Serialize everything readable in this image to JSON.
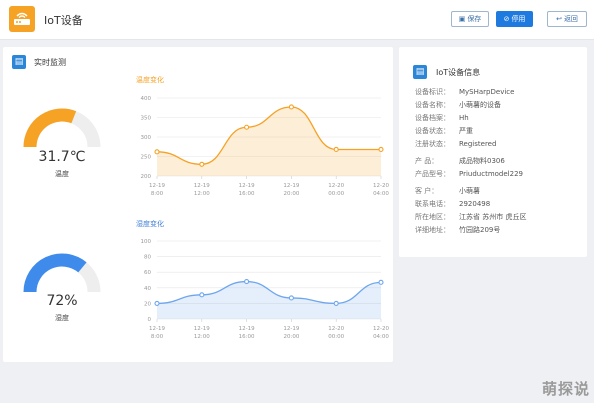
{
  "header": {
    "title": "IoT设备",
    "save_label": "保存",
    "disable_label": "停用",
    "back_label": "返回"
  },
  "monitor": {
    "title": "实时监测",
    "temp_gauge": {
      "value": "31.7℃",
      "label": "温度",
      "level": 0.62,
      "color": "#f5a225"
    },
    "hum_gauge": {
      "value": "72%",
      "label": "湿度",
      "level": 0.72,
      "color": "#3e8bec"
    }
  },
  "info": {
    "title": "IoT设备信息",
    "rows": [
      {
        "key": "设备标识：",
        "value": "MySHarpDevice"
      },
      {
        "key": "设备名称：",
        "value": "小萌薯的设备"
      },
      {
        "key": "设备档案：",
        "value": "Hh"
      },
      {
        "key": "设备状态：",
        "value": "严重"
      },
      {
        "key": "注册状态：",
        "value": "Registered"
      },
      {
        "key": "产    品：",
        "value": "成品物料0306"
      },
      {
        "key": "产品型号：",
        "value": "Priuductmodel229"
      },
      {
        "key": "客    户：",
        "value": "小萌薯"
      },
      {
        "key": "联系电话：",
        "value": "2920498"
      },
      {
        "key": "所在地区：",
        "value": "江苏省 苏州市 虎丘区"
      },
      {
        "key": "详细地址：",
        "value": "竹园路209号"
      }
    ]
  },
  "watermark": "萌探说",
  "chart_data": [
    {
      "type": "area",
      "title": "温度变化",
      "color": "#f5a225",
      "ylim": [
        200,
        400
      ],
      "yticks": [
        "400",
        "350",
        "300",
        "250",
        "200"
      ],
      "xticks": [
        [
          "12-19",
          "8:00"
        ],
        [
          "12-19",
          "12:00"
        ],
        [
          "12-19",
          "16:00"
        ],
        [
          "12-19",
          "20:00"
        ],
        [
          "12-20",
          "00:00"
        ],
        [
          "12-20",
          "04:00"
        ]
      ],
      "values": [
        262,
        230,
        325,
        377,
        268,
        268
      ]
    },
    {
      "type": "area",
      "title": "湿度变化",
      "color": "#6ea6ee",
      "ylim": [
        0,
        100
      ],
      "yticks": [
        "100",
        "80",
        "60",
        "40",
        "20",
        "0"
      ],
      "xticks": [
        [
          "12-19",
          "8:00"
        ],
        [
          "12-19",
          "12:00"
        ],
        [
          "12-19",
          "16:00"
        ],
        [
          "12-19",
          "20:00"
        ],
        [
          "12-20",
          "00:00"
        ],
        [
          "12-20",
          "04:00"
        ]
      ],
      "values": [
        20,
        31,
        48,
        27,
        20,
        47
      ]
    }
  ]
}
